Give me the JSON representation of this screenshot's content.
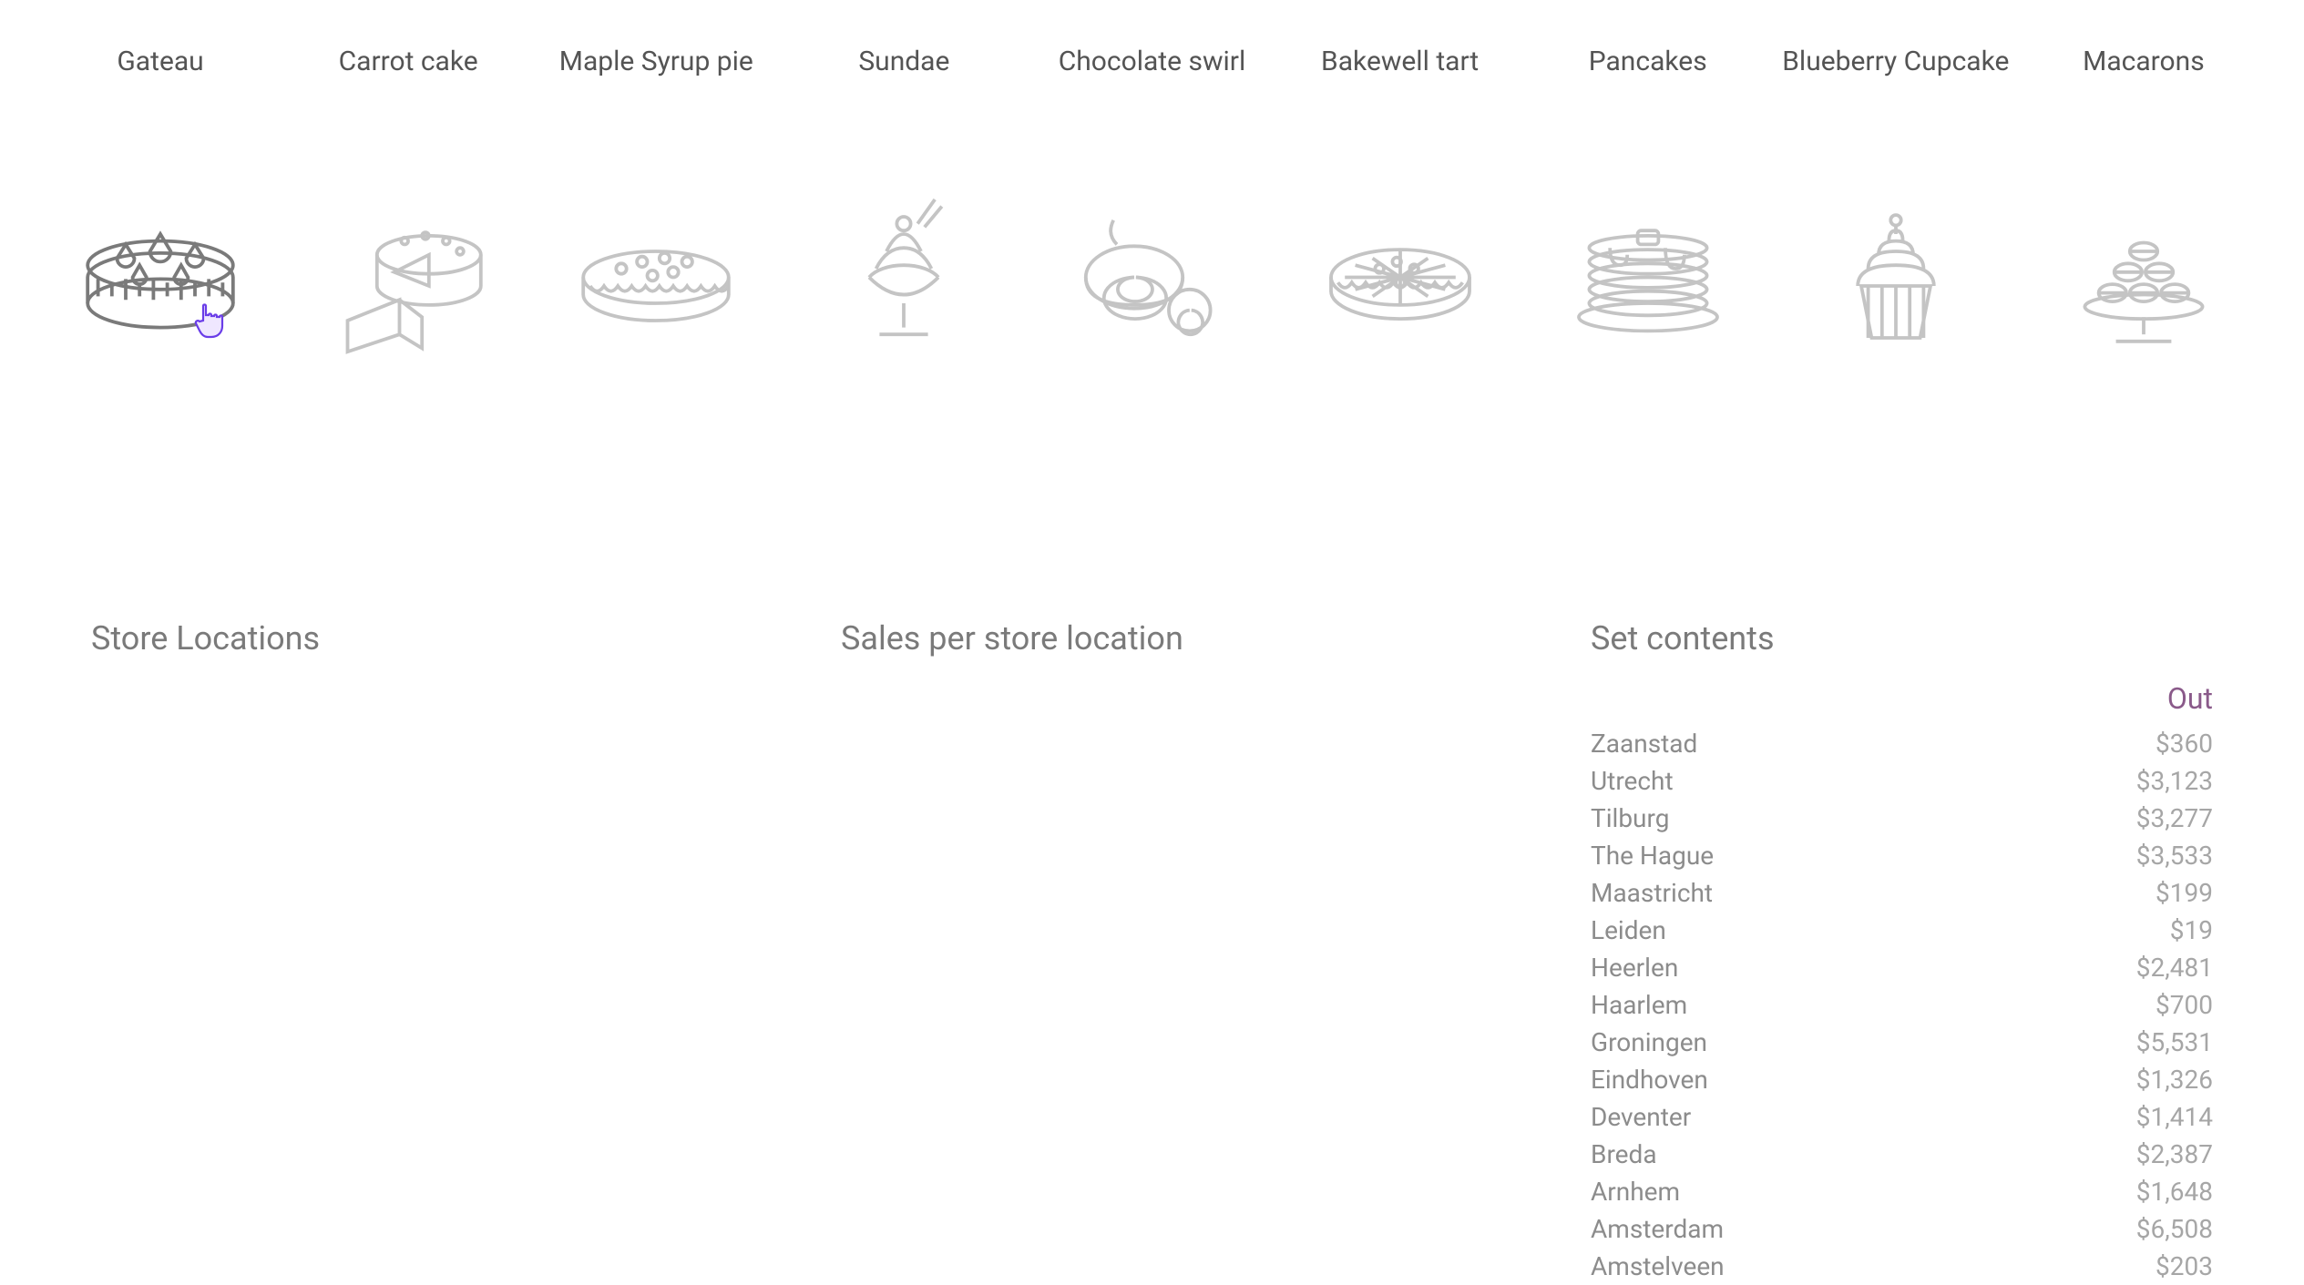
{
  "categories": [
    {
      "label": "Gateau",
      "icon": "gateau-icon",
      "selected": true
    },
    {
      "label": "Carrot cake",
      "icon": "carrot-cake-icon"
    },
    {
      "label": "Maple Syrup pie",
      "icon": "pie-icon"
    },
    {
      "label": "Sundae",
      "icon": "sundae-icon"
    },
    {
      "label": "Chocolate swirl",
      "icon": "swirl-roll-icon"
    },
    {
      "label": "Bakewell tart",
      "icon": "tart-icon"
    },
    {
      "label": "Pancakes",
      "icon": "pancakes-icon"
    },
    {
      "label": "Blueberry Cupcake",
      "icon": "cupcake-icon"
    },
    {
      "label": "Macarons",
      "icon": "macarons-icon"
    }
  ],
  "panels": {
    "locations_title": "Store Locations",
    "sales_title": "Sales per store location",
    "set_title": "Set contents"
  },
  "set_header": "Out",
  "set_rows": [
    {
      "city": "Zaanstad",
      "value": "$360"
    },
    {
      "city": "Utrecht",
      "value": "$3,123"
    },
    {
      "city": "Tilburg",
      "value": "$3,277"
    },
    {
      "city": "The Hague",
      "value": "$3,533"
    },
    {
      "city": "Maastricht",
      "value": "$199"
    },
    {
      "city": "Leiden",
      "value": "$19"
    },
    {
      "city": "Heerlen",
      "value": "$2,481"
    },
    {
      "city": "Haarlem",
      "value": "$700"
    },
    {
      "city": "Groningen",
      "value": "$5,531"
    },
    {
      "city": "Eindhoven",
      "value": "$1,326"
    },
    {
      "city": "Deventer",
      "value": "$1,414"
    },
    {
      "city": "Breda",
      "value": "$2,387"
    },
    {
      "city": "Arnhem",
      "value": "$1,648"
    },
    {
      "city": "Amsterdam",
      "value": "$6,508"
    },
    {
      "city": "Amstelveen",
      "value": "$203"
    }
  ]
}
